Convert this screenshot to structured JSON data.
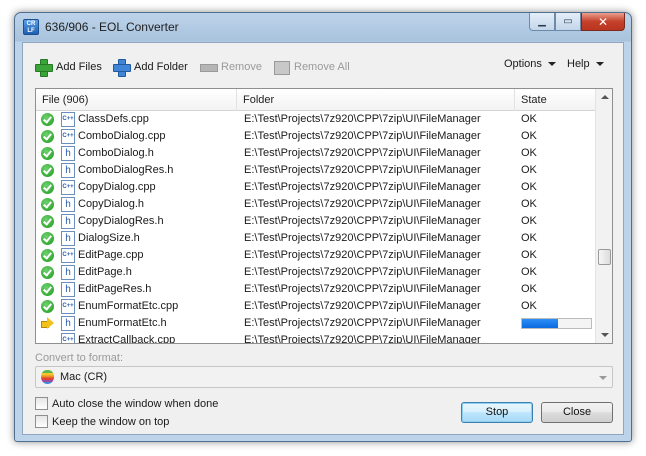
{
  "window": {
    "title": "636/906 - EOL Converter",
    "icon_name": "eol-converter-app-icon",
    "minimize_icon": "minimize-icon",
    "maximize_icon": "maximize-icon",
    "close_icon": "close-icon"
  },
  "toolbar": {
    "add_files": "Add Files",
    "add_folder": "Add Folder",
    "remove": "Remove",
    "remove_all": "Remove All",
    "options": "Options",
    "help": "Help"
  },
  "list": {
    "headers": {
      "file": "File (906)",
      "folder": "Folder",
      "state": "State"
    },
    "rows": [
      {
        "status": "ok",
        "type": "cpp",
        "file": "ClassDefs.cpp",
        "folder": "E:\\Test\\Projects\\7z920\\CPP\\7zip\\UI\\FileManager",
        "state": "OK"
      },
      {
        "status": "ok",
        "type": "cpp",
        "file": "ComboDialog.cpp",
        "folder": "E:\\Test\\Projects\\7z920\\CPP\\7zip\\UI\\FileManager",
        "state": "OK"
      },
      {
        "status": "ok",
        "type": "h",
        "file": "ComboDialog.h",
        "folder": "E:\\Test\\Projects\\7z920\\CPP\\7zip\\UI\\FileManager",
        "state": "OK"
      },
      {
        "status": "ok",
        "type": "h",
        "file": "ComboDialogRes.h",
        "folder": "E:\\Test\\Projects\\7z920\\CPP\\7zip\\UI\\FileManager",
        "state": "OK"
      },
      {
        "status": "ok",
        "type": "cpp",
        "file": "CopyDialog.cpp",
        "folder": "E:\\Test\\Projects\\7z920\\CPP\\7zip\\UI\\FileManager",
        "state": "OK"
      },
      {
        "status": "ok",
        "type": "h",
        "file": "CopyDialog.h",
        "folder": "E:\\Test\\Projects\\7z920\\CPP\\7zip\\UI\\FileManager",
        "state": "OK"
      },
      {
        "status": "ok",
        "type": "h",
        "file": "CopyDialogRes.h",
        "folder": "E:\\Test\\Projects\\7z920\\CPP\\7zip\\UI\\FileManager",
        "state": "OK"
      },
      {
        "status": "ok",
        "type": "h",
        "file": "DialogSize.h",
        "folder": "E:\\Test\\Projects\\7z920\\CPP\\7zip\\UI\\FileManager",
        "state": "OK"
      },
      {
        "status": "ok",
        "type": "cpp",
        "file": "EditPage.cpp",
        "folder": "E:\\Test\\Projects\\7z920\\CPP\\7zip\\UI\\FileManager",
        "state": "OK"
      },
      {
        "status": "ok",
        "type": "h",
        "file": "EditPage.h",
        "folder": "E:\\Test\\Projects\\7z920\\CPP\\7zip\\UI\\FileManager",
        "state": "OK"
      },
      {
        "status": "ok",
        "type": "h",
        "file": "EditPageRes.h",
        "folder": "E:\\Test\\Projects\\7z920\\CPP\\7zip\\UI\\FileManager",
        "state": "OK"
      },
      {
        "status": "ok",
        "type": "cpp",
        "file": "EnumFormatEtc.cpp",
        "folder": "E:\\Test\\Projects\\7z920\\CPP\\7zip\\UI\\FileManager",
        "state": "OK"
      },
      {
        "status": "processing",
        "type": "h",
        "file": "EnumFormatEtc.h",
        "folder": "E:\\Test\\Projects\\7z920\\CPP\\7zip\\UI\\FileManager",
        "state": "",
        "progress": 0.52
      },
      {
        "status": "pending",
        "type": "cpp",
        "file": "ExtractCallback.cpp",
        "folder": "E:\\Test\\Projects\\7z920\\CPP\\7zip\\UI\\FileManager",
        "state": ""
      }
    ]
  },
  "convert": {
    "label": "Convert to format:",
    "selected": "Mac  (CR)",
    "icon_name": "apple-icon"
  },
  "options": {
    "auto_close_label": "Auto close the window when done",
    "auto_close_checked": false,
    "keep_on_top_label": "Keep the window on top",
    "keep_on_top_checked": false
  },
  "buttons": {
    "stop": "Stop",
    "close": "Close"
  },
  "colors": {
    "progress": "#0a6ae0",
    "ok_green": "#1c9a1c",
    "titlebar": "#bcd3ea",
    "close_red": "#c4402a"
  }
}
